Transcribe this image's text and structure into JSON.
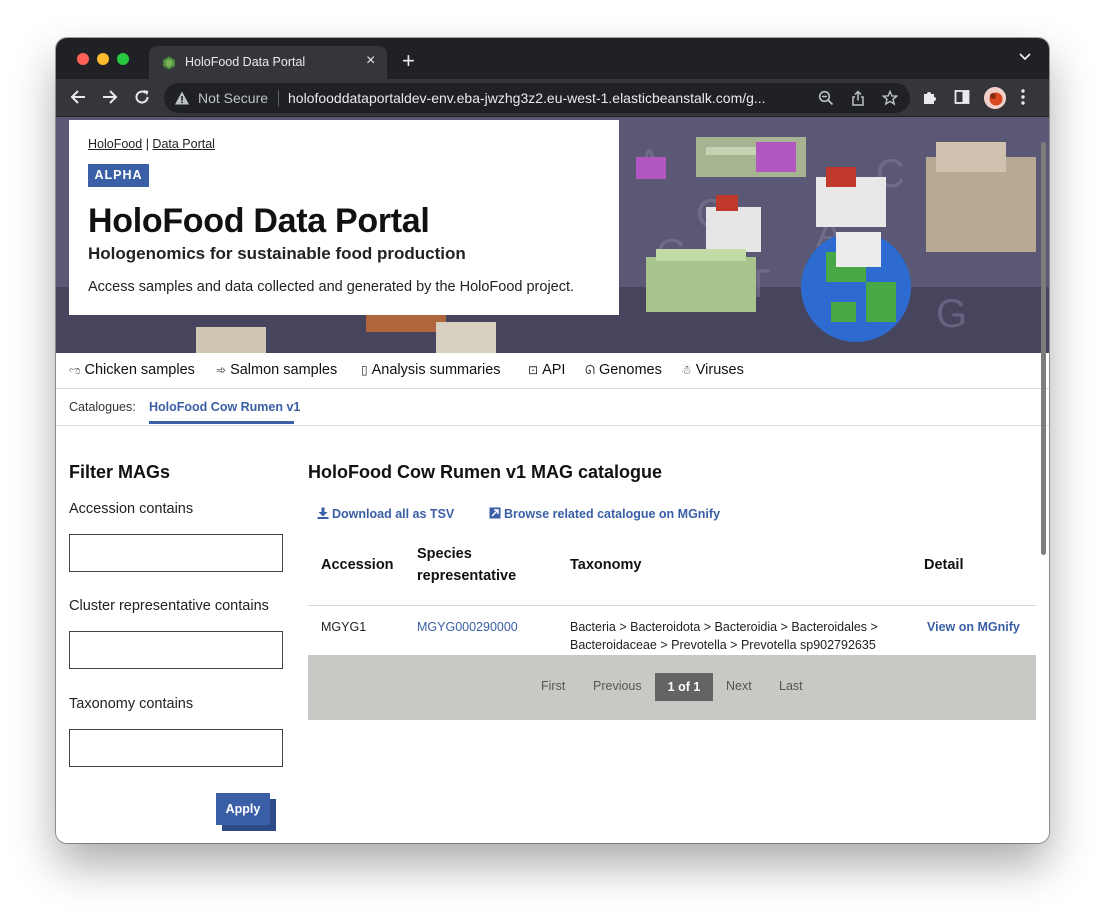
{
  "browser": {
    "tab_title": "HoloFood Data Portal",
    "security_label": "Not Secure",
    "url": "holofooddataportaldev-env.eba-jwzhg3z2.eu-west-1.elasticbeanstalk.com/g..."
  },
  "hero": {
    "crumb_1": "HoloFood",
    "crumb_sep": "|",
    "crumb_2": "Data Portal",
    "badge": "ALPHA",
    "title": "HoloFood Data Portal",
    "subtitle": "Hologenomics for sustainable food production",
    "description": "Access samples and data collected and generated by the HoloFood project."
  },
  "nav": {
    "items": [
      {
        "label": "Chicken samples",
        "icon": "chicken-icon"
      },
      {
        "label": "Salmon samples",
        "icon": "fish-icon"
      },
      {
        "label": "Analysis summaries",
        "icon": "book-icon"
      },
      {
        "label": "API",
        "icon": "terminal-icon"
      },
      {
        "label": "Genomes",
        "icon": "dna-icon"
      },
      {
        "label": "Viruses",
        "icon": "virus-icon"
      }
    ]
  },
  "catalogues": {
    "label": "Catalogues:",
    "active": "HoloFood Cow Rumen v1"
  },
  "filter": {
    "title": "Filter MAGs",
    "accession_label": "Accession contains",
    "accession_value": "",
    "cluster_label": "Cluster representative contains",
    "cluster_value": "",
    "taxonomy_label": "Taxonomy contains",
    "taxonomy_value": "",
    "apply_label": "Apply"
  },
  "catalogue": {
    "heading": "HoloFood Cow Rumen v1 MAG catalogue",
    "download_label": "Download all as TSV",
    "browse_label": "Browse related catalogue on MGnify",
    "columns": {
      "accession": "Accession",
      "species_line1": "Species",
      "species_line2": "representative",
      "taxonomy": "Taxonomy",
      "detail": "Detail"
    },
    "rows": [
      {
        "accession": "MGYG1",
        "species": "MGYG000290000",
        "taxonomy_line1": "Bacteria > Bacteroidota > Bacteroidia > Bacteroidales >",
        "taxonomy_line2": "Bacteroidaceae > Prevotella > Prevotella sp902792635",
        "detail": "View on MGnify"
      }
    ]
  },
  "pagination": {
    "first": "First",
    "previous": "Previous",
    "current": "1 of 1",
    "next": "Next",
    "last": "Last"
  },
  "colors": {
    "accent": "#3a5fa7",
    "tab_strip": "#202124",
    "toolbar": "#35363a"
  }
}
